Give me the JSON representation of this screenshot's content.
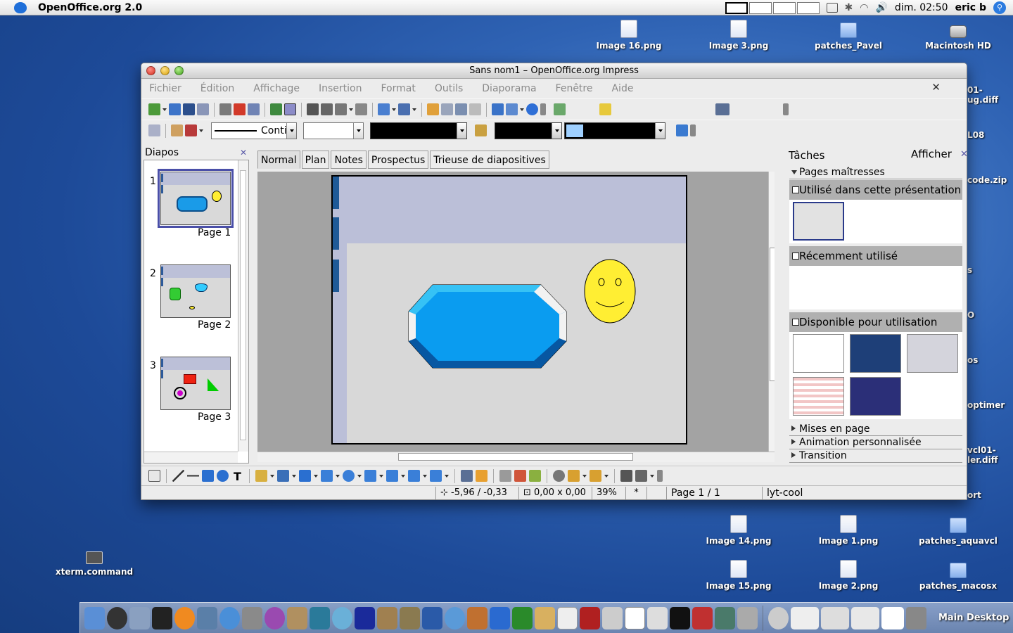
{
  "menubar": {
    "app_name": "OpenOffice.org 2.0",
    "clock": "dim. 02:50",
    "user": "eric b"
  },
  "desktop_icons": [
    {
      "label": "Image 16.png",
      "kind": "png"
    },
    {
      "label": "Image 3.png",
      "kind": "png"
    },
    {
      "label": "patches_Pavel",
      "kind": "folder"
    },
    {
      "label": "Macintosh HD",
      "kind": "drive"
    },
    {
      "label": "Image 14.png",
      "kind": "png"
    },
    {
      "label": "Image 1.png",
      "kind": "png"
    },
    {
      "label": "patches_aquavcl",
      "kind": "folder"
    },
    {
      "label": "Image 15.png",
      "kind": "png"
    },
    {
      "label": "Image 2.png",
      "kind": "png"
    },
    {
      "label": "patches_macosx",
      "kind": "folder"
    },
    {
      "label": "xterm.command",
      "kind": "terminal"
    }
  ],
  "edge_labels": [
    "01-",
    "ug.diff",
    "L08",
    "code.zip",
    "s",
    "O",
    "os",
    "optimer",
    "vcl01-",
    "ler.diff",
    "ort"
  ],
  "window": {
    "title": "Sans nom1 – OpenOffice.org Impress",
    "menus": [
      "Fichier",
      "Édition",
      "Affichage",
      "Insertion",
      "Format",
      "Outils",
      "Diaporama",
      "Fenêtre",
      "Aide"
    ],
    "line_style": "Conti"
  },
  "slides_panel": {
    "title": "Diapos",
    "slides": [
      {
        "number": "1",
        "label": "Page 1"
      },
      {
        "number": "2",
        "label": "Page 2"
      },
      {
        "number": "3",
        "label": "Page 3"
      }
    ]
  },
  "view_tabs": [
    "Normal",
    "Plan",
    "Notes",
    "Prospectus",
    "Trieuse de diapositives"
  ],
  "tasks": {
    "title": "Tâches",
    "view_label": "Afficher",
    "master_pages": "Pages maîtresses",
    "used": "Utilisé dans cette présentation",
    "recent": "Récemment utilisé",
    "available": "Disponible pour utilisation",
    "layout": "Mises en page",
    "animation": "Animation personnalisée",
    "transition": "Transition"
  },
  "status": {
    "position": "-5,96 / -0,33",
    "size": "0,00 x 0,00",
    "zoom": "39%",
    "modified": "*",
    "page": "Page 1 / 1",
    "master": "lyt-cool"
  },
  "dock": {
    "label": "Main Desktop"
  },
  "colors": {
    "accent": "#1f6fd9",
    "shape_fill": "#1a9be8",
    "smiley": "#ffee33",
    "slide_band": "#bbbfd8"
  }
}
